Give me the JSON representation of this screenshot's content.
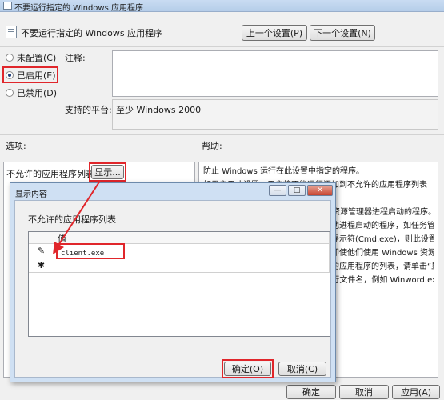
{
  "window": {
    "title": "不要运行指定的 Windows 应用程序"
  },
  "header": {
    "policy_title": "不要运行指定的 Windows 应用程序",
    "prev_label": "上一个设置(P)",
    "next_label": "下一个设置(N)"
  },
  "options": {
    "not_configured": "未配置(C)",
    "enabled": "已启用(E)",
    "disabled": "已禁用(D)",
    "selected": "enabled"
  },
  "comment": {
    "label": "注释:",
    "value": ""
  },
  "platform": {
    "label": "支持的平台:",
    "value": "至少 Windows 2000"
  },
  "sections": {
    "options_label": "选项:",
    "help_label": "帮助:"
  },
  "option_row": {
    "label": "不允许的应用程序列表",
    "show_label": "显示..."
  },
  "help": {
    "lines": [
      "防止 Windows 运行在此设置中指定的程序。",
      "如果启用此设置，用户将不能运行添加到不允许的应用程序列表",
      "此设置只禁止用户运行由 Windows 资源管理器进程启动的程序。",
      "它不会禁止用户运行由系统进程或其他进程启动的程序，如任务管",
      "理器。另外，如果用户有权访问命令提示符(Cmd.exe)，则此设置",
      "不能防止用户从命令窗口启动程序，即使他们使用 Windows 资源管",
      "理器启动这些程序。若要创建不允许的应用程序的列表，请单击“显示”，",
      "然后在“值”列中，键入应用程序可执行文件名，例如 Winword.exe、Poledit.exe 和"
    ]
  },
  "dialog": {
    "title": "显示内容",
    "list_label": "不允许的应用程序列表",
    "column_header": "值",
    "rows": [
      {
        "marker": "✎",
        "value": "client.exe"
      },
      {
        "marker": "✱",
        "value": ""
      }
    ],
    "ok_label": "确定(O)",
    "cancel_label": "取消(C)"
  },
  "footer": {
    "ok_label": "确定",
    "cancel_label": "取消",
    "apply_label": "应用(A)"
  },
  "colors": {
    "highlight": "#e0262b",
    "titlebar": "#c9dcf2"
  }
}
